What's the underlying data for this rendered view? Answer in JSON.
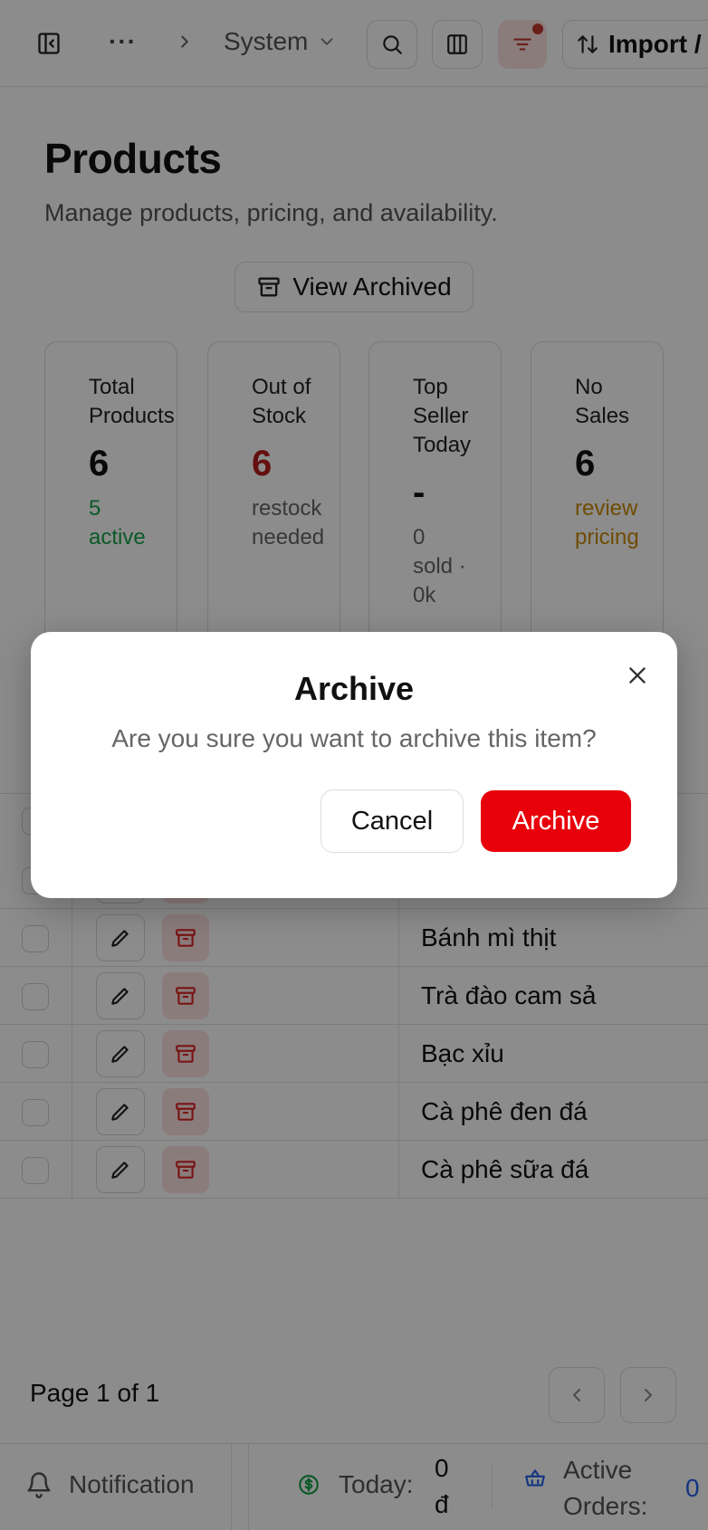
{
  "breadcrumb": {
    "ellipsis": "···",
    "current": "System"
  },
  "toolbar": {
    "import_label": "Import /"
  },
  "header": {
    "title": "Products",
    "subtitle": "Manage products, pricing, and availability.",
    "view_archived_label": "View Archived"
  },
  "cards": [
    {
      "label": "Total Products",
      "value": "6",
      "note": "5 active",
      "note_color": "#16a34a",
      "value_color": "#111111"
    },
    {
      "label": "Out of Stock",
      "value": "6",
      "note": "restock needed",
      "note_color": "#666666",
      "value_color": "#b91c1c"
    },
    {
      "label": "Top Seller Today",
      "value": "-",
      "note": "0 sold · 0k",
      "note_color": "#666666",
      "value_color": "#111111"
    },
    {
      "label": "No Sales",
      "value": "6",
      "note": "review pricing",
      "note_color": "#ca8a04",
      "value_color": "#111111"
    }
  ],
  "table": {
    "rows": [
      {
        "name": ""
      },
      {
        "name": "Bánh mì thịt"
      },
      {
        "name": "Trà đào cam sả"
      },
      {
        "name": "Bạc xỉu"
      },
      {
        "name": "Cà phê đen đá"
      },
      {
        "name": "Cà phê sữa đá"
      }
    ]
  },
  "pagination": {
    "label": "Page 1 of 1"
  },
  "statusbar": {
    "notification_label": "Notification",
    "today_label": "Today:",
    "today_value": "0",
    "today_currency": "đ",
    "active_orders_label": "Active Orders:",
    "active_orders_value": "0"
  },
  "modal": {
    "title": "Archive",
    "message": "Are you sure you want to archive this item?",
    "cancel_label": "Cancel",
    "confirm_label": "Archive"
  },
  "colors": {
    "danger": "#e8000b",
    "danger_soft": "#fde2e2",
    "success": "#16a34a",
    "warning": "#ca8a04",
    "overlay": "rgba(0,0,0,0.45)"
  }
}
